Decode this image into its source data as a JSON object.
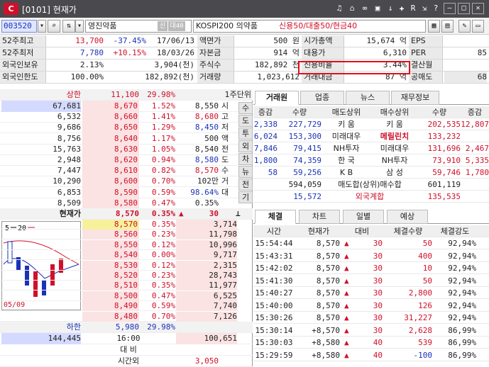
{
  "app": {
    "window_title": "[0101] 현재가",
    "logo_letter": "C"
  },
  "toolbar": {
    "code": "003520",
    "name": "영진약품",
    "tag1": "신",
    "tag2": "대40",
    "index": "KOSPI200 의약품",
    "credit": "신용50/대출50/현금40"
  },
  "info": {
    "r1": {
      "l": "52주최고",
      "v1": "13,700",
      "v2": "-37.45%",
      "v3": "17/06/13",
      "k2": "액면가",
      "v4": "500 원",
      "k3": "시가총액",
      "v5": "15,674 억",
      "k4": "EPS",
      "v6": ""
    },
    "r2": {
      "l": "52주최저",
      "v1": "7,780",
      "v2": "+10.15%",
      "v3": "18/03/26",
      "k2": "자본금",
      "v4": "914 억",
      "k3": "대용가",
      "v5": "6,310",
      "k4": "PER",
      "v6": "85"
    },
    "r3": {
      "l": "외국인보유",
      "v1": "2.13%",
      "v3": "3,904(천)",
      "k2": "주식수",
      "v4": "182,892 천",
      "k3": "신용비율",
      "v5": "3.44%",
      "k4": "결산월",
      "v6": ""
    },
    "r4": {
      "l": "외국인한도",
      "v1": "100.00%",
      "v3": "182,892(천)",
      "k2": "거래량",
      "v4": "1,023,612",
      "k3": "거래대금",
      "v5": "87 억",
      "k4": "공매도",
      "v6": "68"
    }
  },
  "orderbook": {
    "upper": {
      "label": "상한",
      "price": "11,100",
      "pct": "29.98%",
      "unit": "1주단위"
    },
    "asks": [
      [
        "67,681",
        "8,670",
        "1.52%",
        "8,550",
        "시"
      ],
      [
        "6,532",
        "8,660",
        "1.41%",
        "8,680",
        "고"
      ],
      [
        "9,686",
        "8,650",
        "1.29%",
        "8,450",
        "저"
      ],
      [
        "8,756",
        "8,640",
        "1.17%",
        "500",
        "액"
      ],
      [
        "15,763",
        "8,630",
        "1.05%",
        "8,540",
        "전"
      ],
      [
        "2,948",
        "8,620",
        "0.94%",
        "8,580",
        "도"
      ],
      [
        "7,447",
        "8,610",
        "0.82%",
        "8,570",
        "수"
      ],
      [
        "10,290",
        "8,600",
        "0.70%",
        "102만",
        "거"
      ],
      [
        "6,853",
        "8,590",
        "0.59%",
        "98.64%",
        "대"
      ],
      [
        "8,509",
        "8,580",
        "0.47%",
        "0.35%",
        ""
      ]
    ],
    "side_tabs": [
      "수",
      "도",
      "투",
      "외",
      "차",
      "뉴",
      "전",
      "기"
    ],
    "current": {
      "label": "현재가",
      "price": "8,570",
      "pct": "0.35%",
      "arrow": "▲",
      "diff": "30"
    },
    "bids": [
      [
        "8,570",
        "0.35%",
        "3,714"
      ],
      [
        "8,560",
        "0.23%",
        "11,798"
      ],
      [
        "8,550",
        "0.12%",
        "10,996"
      ],
      [
        "8,540",
        "0.00%",
        "9,717"
      ],
      [
        "8,530",
        "0.12%",
        "2,315"
      ],
      [
        "8,520",
        "0.23%",
        "28,743"
      ],
      [
        "8,510",
        "0.35%",
        "11,977"
      ],
      [
        "8,500",
        "0.47%",
        "6,525"
      ],
      [
        "8,490",
        "0.59%",
        "7,740"
      ],
      [
        "8,480",
        "0.70%",
        "7,126"
      ]
    ],
    "lower": {
      "label": "하한",
      "price": "5,980",
      "pct": "29.98%"
    },
    "total": {
      "ask": "144,445",
      "time": "16:00",
      "bid": "100,651"
    },
    "foot1": "대 비",
    "foot2": "시간외",
    "foot2v": "3,050",
    "mini_chart": {
      "label1": "5",
      "label2": "20",
      "date": "05/09"
    }
  },
  "broker": {
    "tabs": [
      "거래원",
      "업종",
      "뉴스",
      "재무정보"
    ],
    "head": [
      "증감",
      "수량",
      "매도상위",
      "매수상위",
      "수량",
      "증감"
    ],
    "rows": [
      [
        "2,338",
        "227,729",
        "키 움",
        "키 움",
        "202,535",
        "12,807"
      ],
      [
        "6,024",
        "153,300",
        "미래대우",
        "메릴린치",
        "133,232",
        ""
      ],
      [
        "7,846",
        "79,415",
        "NH투자",
        "미래대우",
        "131,696",
        "2,467"
      ],
      [
        "1,800",
        "74,359",
        "한 국",
        "NH투자",
        "73,910",
        "5,335"
      ],
      [
        "58",
        "59,256",
        "K B",
        "삼 성",
        "59,746",
        "1,780"
      ]
    ],
    "sum": [
      "594,059",
      "매도합(상위)매수합",
      "601,119"
    ],
    "foreign": [
      "15,572",
      "외국계합",
      "135,535"
    ]
  },
  "trades": {
    "tabs": [
      "체결",
      "차트",
      "일별",
      "예상"
    ],
    "head": [
      "시간",
      "현재가",
      "대비",
      "체결수량",
      "체결강도"
    ],
    "rows": [
      [
        "15:54:44",
        "8,570",
        "30",
        "50",
        "92,94%"
      ],
      [
        "15:43:31",
        "8,570",
        "30",
        "400",
        "92,94%"
      ],
      [
        "15:42:02",
        "8,570",
        "30",
        "10",
        "92,94%"
      ],
      [
        "15:41:30",
        "8,570",
        "30",
        "50",
        "92,94%"
      ],
      [
        "15:40:27",
        "8,570",
        "30",
        "2,800",
        "92,94%"
      ],
      [
        "15:40:00",
        "8,570",
        "30",
        "126",
        "92,94%"
      ],
      [
        "15:30:26",
        "8,570",
        "30",
        "31,227",
        "92,94%"
      ],
      [
        "15:30:14",
        "+8,570",
        "30",
        "2,628",
        "86,99%"
      ],
      [
        "15:30:03",
        "+8,580",
        "40",
        "539",
        "86,99%"
      ],
      [
        "15:29:59",
        "+8,580",
        "40",
        "-100",
        "86,99%"
      ]
    ]
  }
}
